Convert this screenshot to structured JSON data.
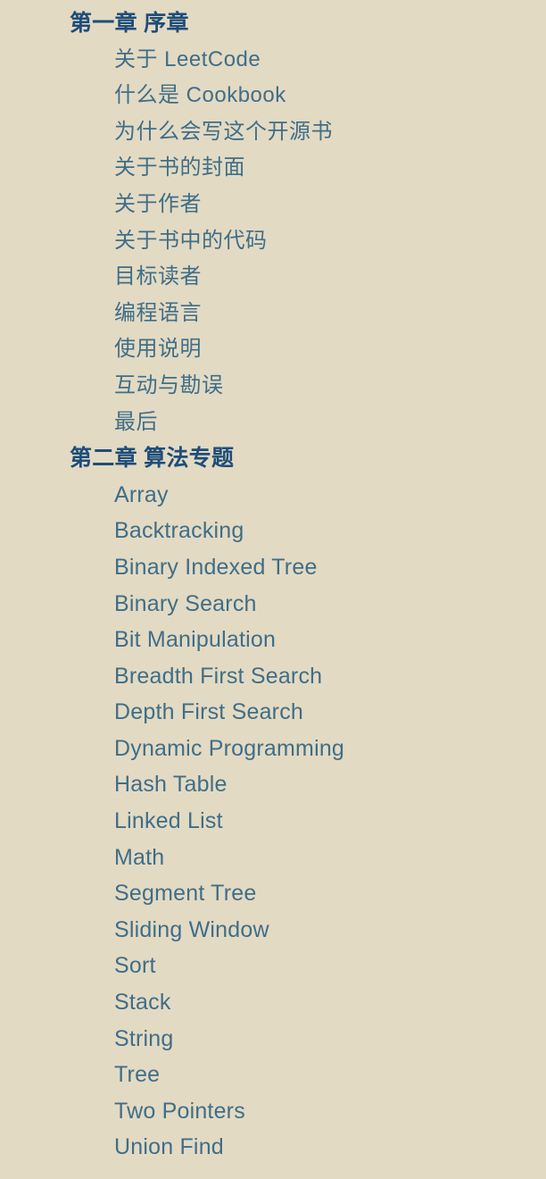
{
  "theme": {
    "background_color": "#e3dac3",
    "heading_color": "#1e4d79",
    "link_color": "#3f6e88"
  },
  "toc": {
    "sections": [
      {
        "heading": "第一章 序章",
        "script": "cjk",
        "items": [
          "关于 LeetCode",
          "什么是 Cookbook",
          "为什么会写这个开源书",
          "关于书的封面",
          "关于作者",
          "关于书中的代码",
          "目标读者",
          "编程语言",
          "使用说明",
          "互动与勘误",
          "最后"
        ]
      },
      {
        "heading": "第二章 算法专题",
        "script": "latin",
        "items": [
          "Array",
          "Backtracking",
          "Binary Indexed Tree",
          "Binary Search",
          "Bit Manipulation",
          "Breadth First Search",
          "Depth First Search",
          "Dynamic Programming",
          "Hash Table",
          "Linked List",
          "Math",
          "Segment Tree",
          "Sliding Window",
          "Sort",
          "Stack",
          "String",
          "Tree",
          "Two Pointers",
          "Union Find"
        ]
      }
    ]
  }
}
